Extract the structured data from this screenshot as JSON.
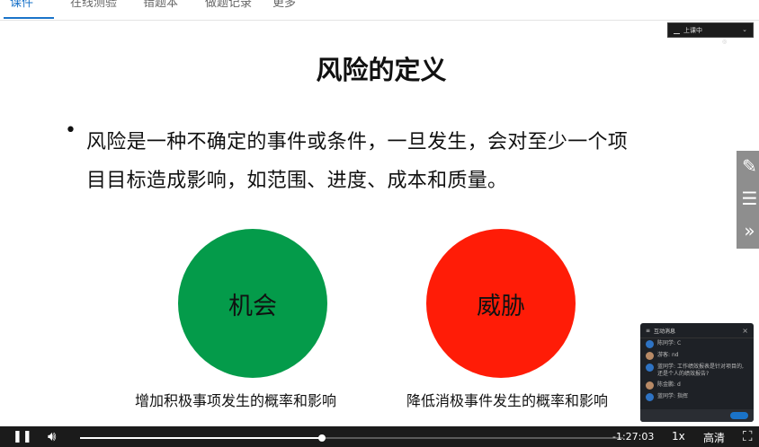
{
  "tabs": [
    {
      "label": "课件",
      "active": true
    },
    {
      "label": "在线测验",
      "active": false
    },
    {
      "label": "错题本",
      "active": false
    },
    {
      "label": "做题记录",
      "active": false
    },
    {
      "label": "更多",
      "active": false
    }
  ],
  "slide": {
    "title": "风险的定义",
    "bullet_line1": "风险是一种不确定的事件或条件，一旦发生，会对至少一个项",
    "bullet_line2": "目目标造成影响，如范围、进度、成本和质量。",
    "opportunity": {
      "label": "机会",
      "caption": "增加积极事项发生的概率和影响",
      "color": "#049b4a"
    },
    "threat": {
      "label": "威胁",
      "caption": "降低消极事件发生的概率和影响",
      "color": "#ff1c07"
    }
  },
  "live_badge": {
    "label": "上课中"
  },
  "chat": {
    "title": "互动消息",
    "messages": [
      {
        "name": "陈同学",
        "text": "C"
      },
      {
        "name": "游客",
        "text": "nd"
      },
      {
        "name": "蓝同学",
        "text": "工作绩效报表是针对项目的, 还是个人的绩效报告?"
      },
      {
        "name": "陈金鹏",
        "text": "d"
      },
      {
        "name": "蓝同学",
        "text": "指挥"
      }
    ]
  },
  "player": {
    "time": "-1:27:03",
    "speed": "1x",
    "quality": "高清",
    "progress": 0.445
  }
}
